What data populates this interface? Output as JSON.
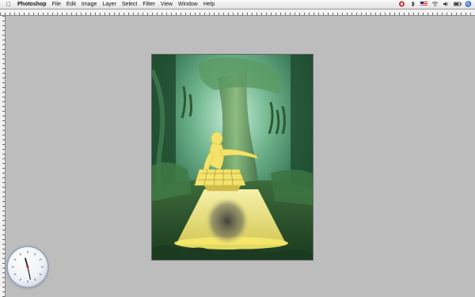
{
  "menubar": {
    "apple_icon": "apple-logo",
    "app_name": "Photoshop",
    "items": [
      "File",
      "Edit",
      "Image",
      "Layer",
      "Select",
      "Filter",
      "View",
      "Window",
      "Help"
    ],
    "status_icons": [
      "alert-icon",
      "bluetooth-icon",
      "flag-us-icon",
      "wifi-icon",
      "volume-icon",
      "battery-icon",
      "spotlight-icon"
    ]
  },
  "document": {
    "description_icon": "forest-composite-image"
  },
  "clock": {
    "widget": "analog-clock",
    "hour": 11,
    "minute": 28
  }
}
